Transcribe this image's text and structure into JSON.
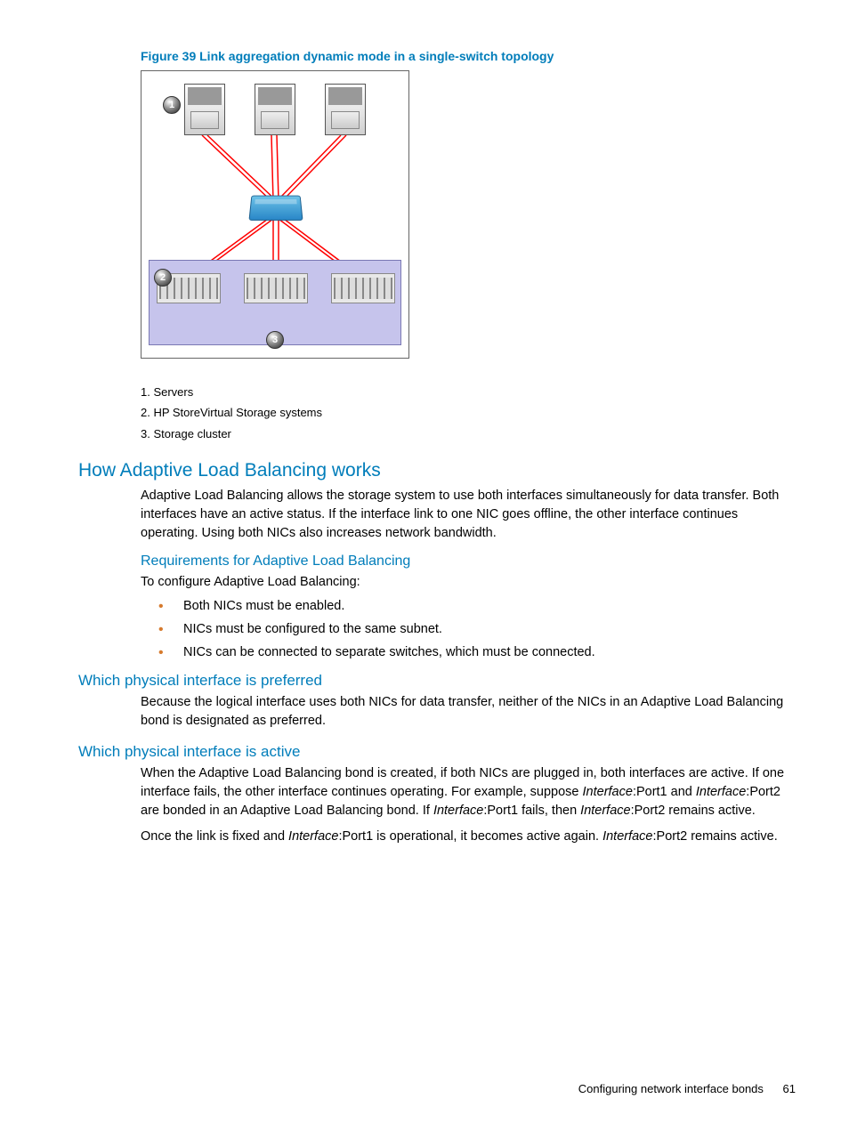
{
  "figure": {
    "caption": "Figure 39 Link aggregation dynamic mode in a single-switch topology",
    "callouts": {
      "c1": "1",
      "c2": "2",
      "c3": "3"
    }
  },
  "legend": {
    "l1": "1. Servers",
    "l2": "2. HP StoreVirtual Storage systems",
    "l3": "3. Storage cluster"
  },
  "sections": {
    "how_alb": {
      "title": "How Adaptive Load Balancing works",
      "p1": "Adaptive Load Balancing allows the storage system to use both interfaces simultaneously for data transfer. Both interfaces have an active status. If the interface link to one NIC goes offline, the other interface continues operating. Using both NICs also increases network bandwidth."
    },
    "req": {
      "title": "Requirements for Adaptive Load Balancing",
      "intro": "To configure Adaptive Load Balancing:",
      "b1": "Both NICs must be enabled.",
      "b2": "NICs must be configured to the same subnet.",
      "b3": "NICs can be connected to separate switches, which must be connected."
    },
    "preferred": {
      "title": "Which physical interface is preferred",
      "p1": "Because the logical interface uses both NICs for data transfer, neither of the NICs in an Adaptive Load Balancing bond is designated as preferred."
    },
    "active": {
      "title": "Which physical interface is active",
      "p1_a": "When the Adaptive Load Balancing bond is created, if both NICs are plugged in, both interfaces are active. If one interface fails, the other interface continues operating. For example, suppose ",
      "p1_i1": "Interface",
      "p1_b": ":Port1 and ",
      "p1_i2": "Interface",
      "p1_c": ":Port2 are bonded in an Adaptive Load Balancing bond. If ",
      "p1_i3": "Interface",
      "p1_d": ":Port1 fails, then ",
      "p1_i4": "Interface",
      "p1_e": ":Port2 remains active.",
      "p2_a": "Once the link is fixed and ",
      "p2_i1": "Interface",
      "p2_b": ":Port1 is operational, it becomes active again. ",
      "p2_i2": "Interface",
      "p2_c": ":Port2 remains active."
    }
  },
  "footer": {
    "text": "Configuring network interface bonds",
    "page": "61"
  }
}
